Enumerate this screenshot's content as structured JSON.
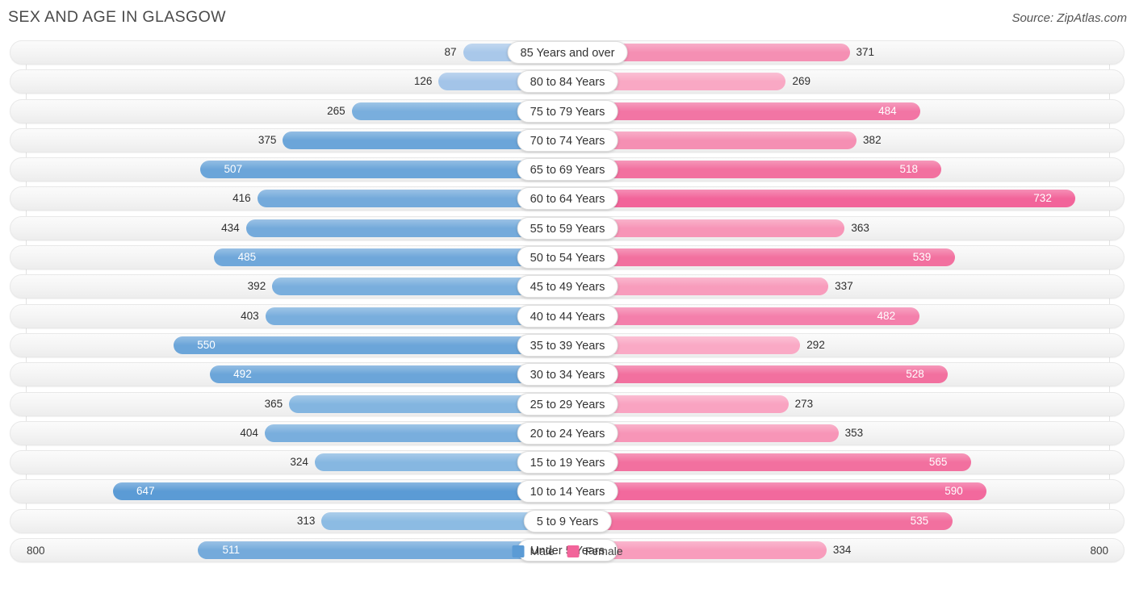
{
  "header": {
    "title": "SEX AND AGE IN GLASGOW",
    "source": "Source: ZipAtlas.com"
  },
  "legend": {
    "male_label": "Male",
    "female_label": "Female",
    "male_color": "#5b9bd5",
    "female_color": "#f2649a"
  },
  "axis": {
    "left_label": "800",
    "right_label": "800",
    "max": 800
  },
  "chart_data": {
    "type": "bar",
    "title": "SEX AND AGE IN GLASGOW",
    "xlabel": "",
    "ylabel": "",
    "orientation": "population-pyramid",
    "xlim": [
      800,
      800
    ],
    "grid": true,
    "legend_position": "bottom-center",
    "categories": [
      "85 Years and over",
      "80 to 84 Years",
      "75 to 79 Years",
      "70 to 74 Years",
      "65 to 69 Years",
      "60 to 64 Years",
      "55 to 59 Years",
      "50 to 54 Years",
      "45 to 49 Years",
      "40 to 44 Years",
      "35 to 39 Years",
      "30 to 34 Years",
      "25 to 29 Years",
      "20 to 24 Years",
      "15 to 19 Years",
      "10 to 14 Years",
      "5 to 9 Years",
      "Under 5 Years"
    ],
    "series": [
      {
        "name": "Male",
        "values": [
          87,
          126,
          265,
          375,
          507,
          416,
          434,
          485,
          392,
          403,
          550,
          492,
          365,
          404,
          324,
          647,
          313,
          511
        ]
      },
      {
        "name": "Female",
        "values": [
          371,
          269,
          484,
          382,
          518,
          732,
          363,
          539,
          337,
          482,
          292,
          528,
          273,
          353,
          565,
          590,
          535,
          334
        ]
      }
    ]
  },
  "rows": [
    {
      "label": "85 Years and over",
      "male": 87,
      "female": 371,
      "male_color": "#a9c8ea",
      "female_color": "#f58fb3",
      "male_inside": false,
      "female_inside": false
    },
    {
      "label": "80 to 84 Years",
      "male": 126,
      "female": 269,
      "male_color": "#a3c4e8",
      "female_color": "#f9a8c4",
      "male_inside": false,
      "female_inside": false
    },
    {
      "label": "75 to 79 Years",
      "male": 265,
      "female": 484,
      "male_color": "#79aedd",
      "female_color": "#f275a4",
      "male_inside": false,
      "female_inside": true
    },
    {
      "label": "70 to 74 Years",
      "male": 375,
      "female": 382,
      "male_color": "#6ba5d9",
      "female_color": "#f58fb3",
      "male_inside": false,
      "female_inside": false
    },
    {
      "label": "65 to 69 Years",
      "male": 507,
      "female": 518,
      "male_color": "#6ba5d9",
      "female_color": "#f2709f",
      "male_inside": true,
      "female_inside": true
    },
    {
      "label": "60 to 64 Years",
      "male": 416,
      "female": 732,
      "male_color": "#74aadb",
      "female_color": "#f2649a",
      "male_inside": false,
      "female_inside": true
    },
    {
      "label": "55 to 59 Years",
      "male": 434,
      "female": 363,
      "male_color": "#74aadb",
      "female_color": "#f795b7",
      "male_inside": false,
      "female_inside": false
    },
    {
      "label": "50 to 54 Years",
      "male": 485,
      "female": 539,
      "male_color": "#6fa7da",
      "female_color": "#f2709f",
      "male_inside": true,
      "female_inside": true
    },
    {
      "label": "45 to 49 Years",
      "male": 392,
      "female": 337,
      "male_color": "#79aedd",
      "female_color": "#f89cbc",
      "male_inside": false,
      "female_inside": false
    },
    {
      "label": "40 to 44 Years",
      "male": 403,
      "female": 482,
      "male_color": "#79aedd",
      "female_color": "#f47fab",
      "male_inside": false,
      "female_inside": true
    },
    {
      "label": "35 to 39 Years",
      "male": 550,
      "female": 292,
      "male_color": "#6ba5d9",
      "female_color": "#faa9c5",
      "male_inside": true,
      "female_inside": false
    },
    {
      "label": "30 to 34 Years",
      "male": 492,
      "female": 528,
      "male_color": "#6ba5d9",
      "female_color": "#f2709f",
      "male_inside": true,
      "female_inside": true
    },
    {
      "label": "25 to 29 Years",
      "male": 365,
      "female": 273,
      "male_color": "#83b5e0",
      "female_color": "#f9a3c1",
      "male_inside": false,
      "female_inside": false
    },
    {
      "label": "20 to 24 Years",
      "male": 404,
      "female": 353,
      "male_color": "#79aedd",
      "female_color": "#f795b7",
      "male_inside": false,
      "female_inside": false
    },
    {
      "label": "15 to 19 Years",
      "male": 324,
      "female": 565,
      "male_color": "#86b7e1",
      "female_color": "#f2709f",
      "male_inside": false,
      "female_inside": true
    },
    {
      "label": "10 to 14 Years",
      "male": 647,
      "female": 590,
      "male_color": "#5b9bd5",
      "female_color": "#f2699d",
      "male_inside": true,
      "female_inside": true
    },
    {
      "label": "5 to 9 Years",
      "male": 313,
      "female": 535,
      "male_color": "#8cbbe3",
      "female_color": "#f2709f",
      "male_inside": false,
      "female_inside": true
    },
    {
      "label": "Under 5 Years",
      "male": 511,
      "female": 334,
      "male_color": "#74aadb",
      "female_color": "#f89cbc",
      "male_inside": true,
      "female_inside": false
    }
  ]
}
